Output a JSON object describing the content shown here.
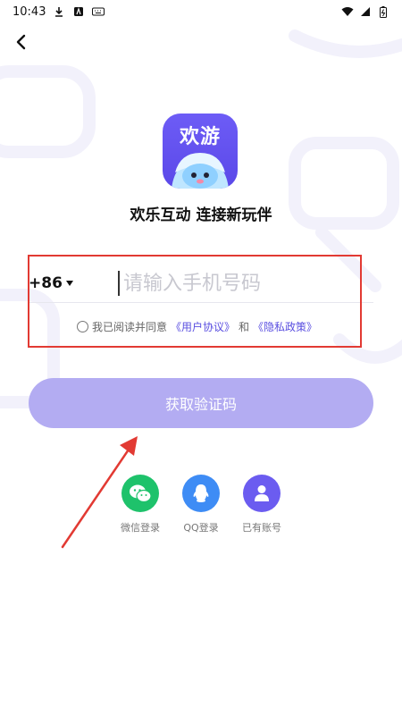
{
  "status_bar": {
    "time": "10:43"
  },
  "logo": {
    "text": "欢游"
  },
  "slogan": "欢乐互动 连接新玩伴",
  "phone": {
    "country_code": "+86",
    "placeholder": "请输入手机号码"
  },
  "agreement": {
    "prefix": "我已阅读并同意",
    "user_agreement": "《用户协议》",
    "conjunction": "和",
    "privacy_policy": "《隐私政策》"
  },
  "cta_label": "获取验证码",
  "social_login": [
    {
      "label": "微信登录",
      "icon": "wechat-icon",
      "color": "#1ec26b"
    },
    {
      "label": "QQ登录",
      "icon": "qq-icon",
      "color": "#3e8cf5"
    },
    {
      "label": "已有账号",
      "icon": "user-icon",
      "color": "#6b5cf0"
    }
  ],
  "colors": {
    "accent": "#5a48e8",
    "cta_disabled": "#b3acf2",
    "highlight_box": "#e23a33"
  }
}
